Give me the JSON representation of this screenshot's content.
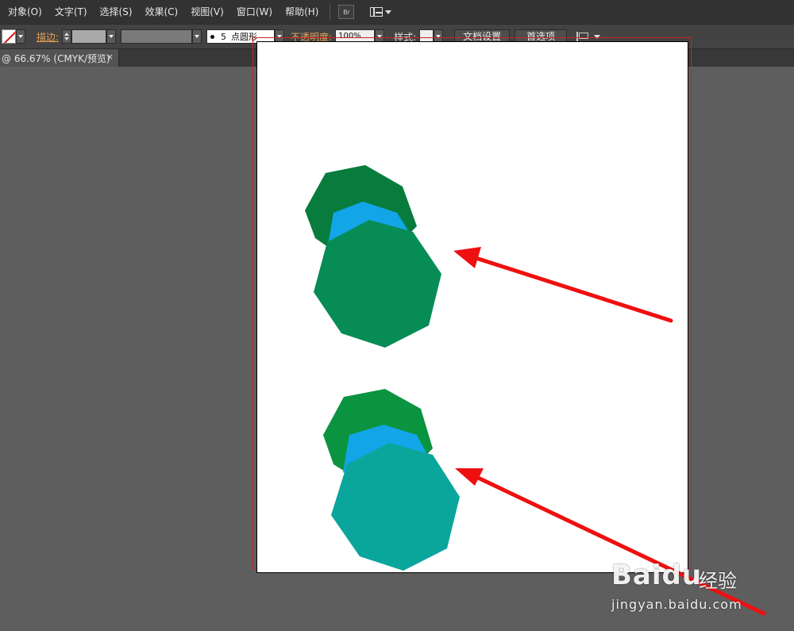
{
  "menubar": {
    "items": [
      "对象(O)",
      "文字(T)",
      "选择(S)",
      "效果(C)",
      "视图(V)",
      "窗口(W)",
      "帮助(H)"
    ],
    "br_label": "Br"
  },
  "controlbar": {
    "stroke_label": "描边:",
    "brush_size": "5",
    "brush_label": "点圆形",
    "opacity_label": "不透明度:",
    "opacity_value": "100%",
    "style_label": "样式:",
    "doc_setup_label": "文档设置",
    "preferences_label": "首选项"
  },
  "tab": {
    "title": "@ 66.67% (CMYK/预览)",
    "close": "×"
  },
  "colors": {
    "dark_green": "#077c3d",
    "blue": "#12a5e8",
    "green": "#078c55",
    "bright_green": "#0b9440",
    "teal": "#0aa69b",
    "arrow_red": "#ee1010"
  },
  "watermark": {
    "brand": "Baidu",
    "cn": "经验",
    "url": "jingyan.baidu.com"
  }
}
